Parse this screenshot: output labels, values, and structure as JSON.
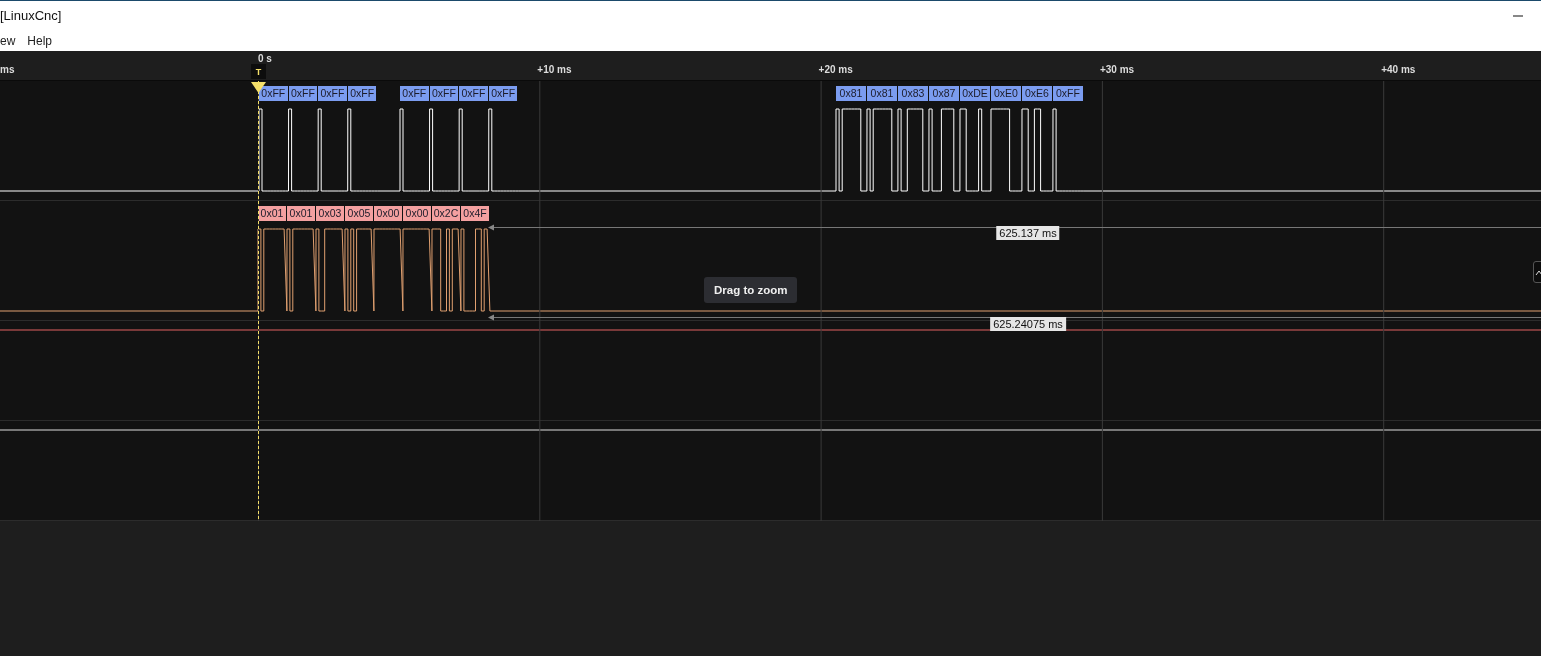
{
  "window": {
    "title": "[LinuxCnc]"
  },
  "menu": [
    "ew",
    "Help"
  ],
  "timeline": {
    "trigger_label": "0 s",
    "trigger_marker": "T",
    "ticks": [
      "ms",
      "+10 ms",
      "+20 ms",
      "+30 ms",
      "+40 ms"
    ]
  },
  "channels": [
    {
      "kind": "decoded",
      "color": "#7b9cf0",
      "groups": [
        [
          "0xFF",
          "0xFF",
          "0xFF",
          "0xFF"
        ],
        [
          "0xFF",
          "0xFF",
          "0xFF",
          "0xFF"
        ],
        [
          "0x81",
          "0x81",
          "0x83",
          "0x87",
          "0xDE",
          "0xE0",
          "0xE6",
          "0xFF"
        ]
      ]
    },
    {
      "kind": "decoded",
      "color": "#f4a0a0",
      "groups": [
        [
          "0x01",
          "0x01",
          "0x03",
          "0x05",
          "0x00",
          "0x00",
          "0x2C",
          "0x4F"
        ]
      ]
    },
    {
      "kind": "idle"
    },
    {
      "kind": "idle"
    }
  ],
  "measurements": [
    "625.137 ms",
    "625.24075 ms"
  ],
  "tooltip": "Drag to zoom"
}
